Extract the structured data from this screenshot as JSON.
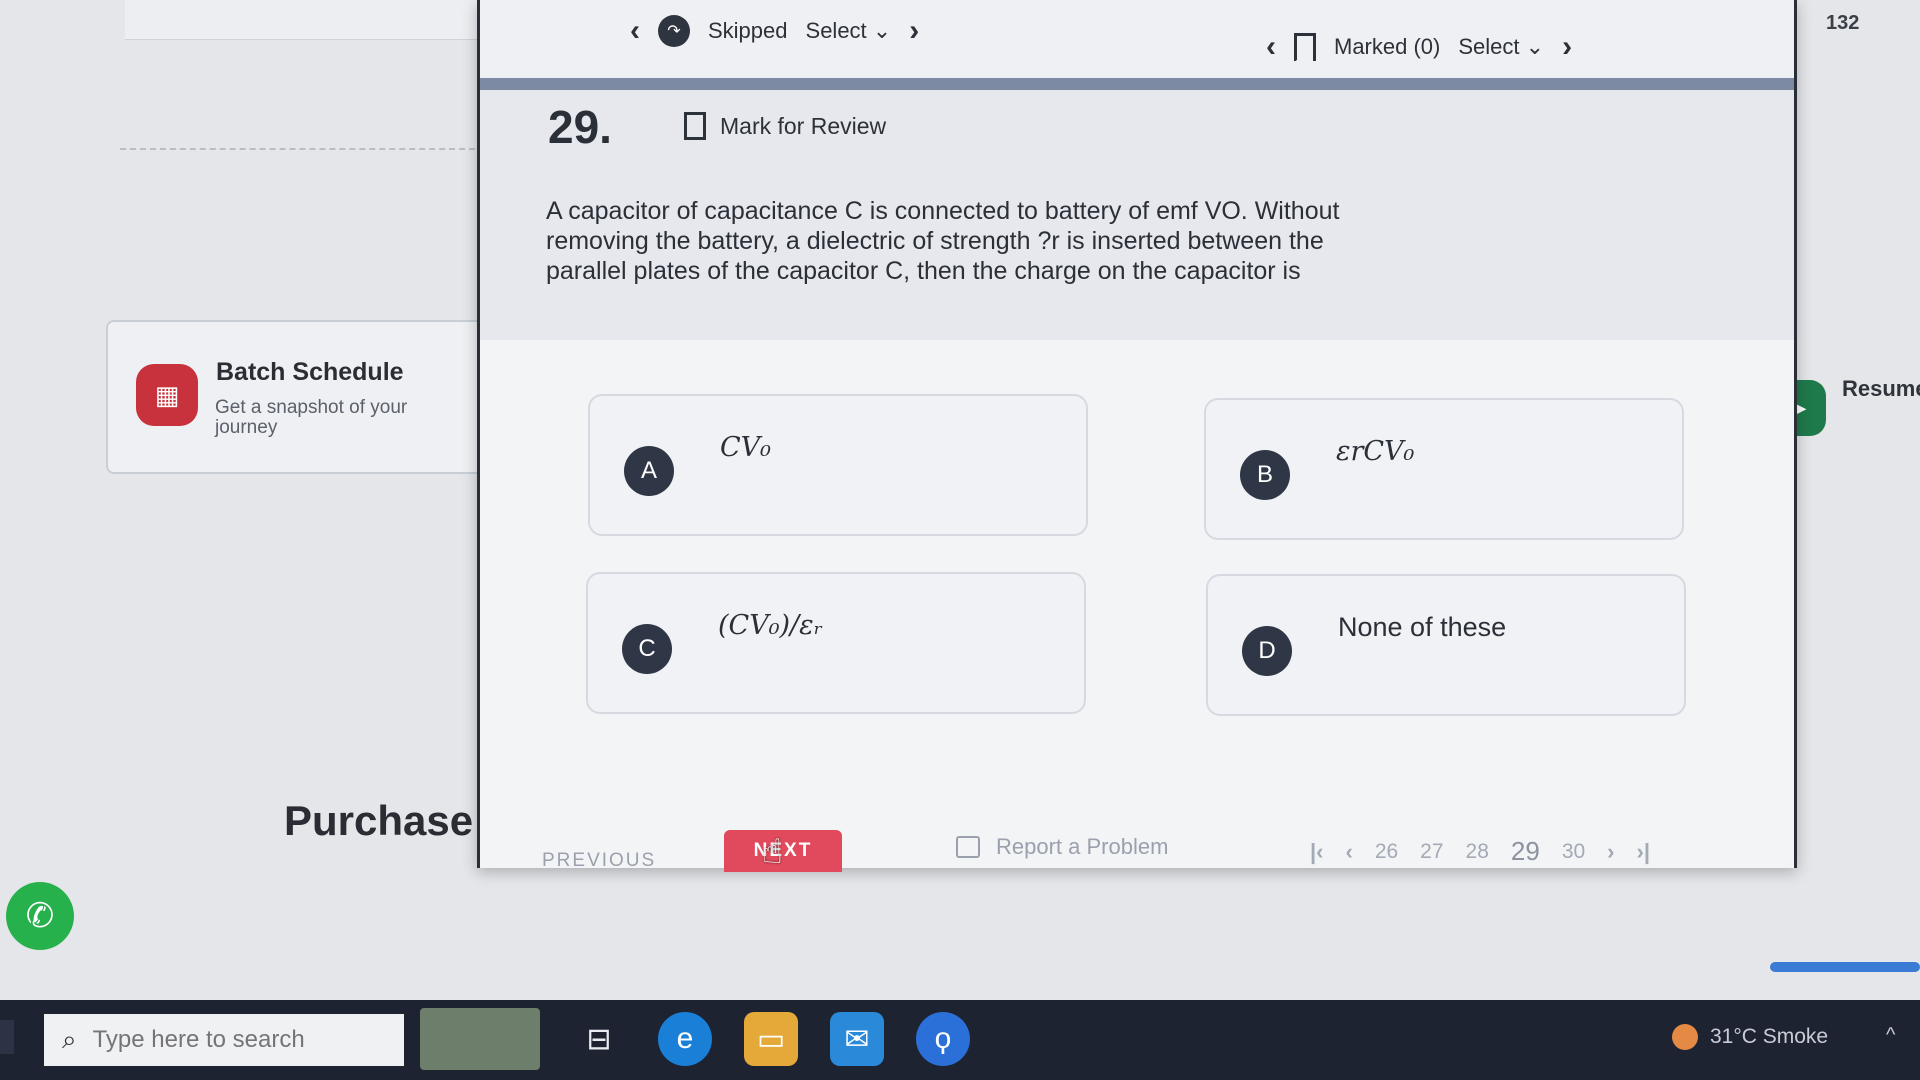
{
  "header": {
    "skipped_label": "Skipped",
    "skipped_select": "Select",
    "marked_label": "Marked (0)",
    "marked_select": "Select",
    "counter": "132"
  },
  "question": {
    "number": "29.",
    "mark_for_review": "Mark for Review",
    "text": "A capacitor of capacitance C is connected to battery of emf VO. Without removing the battery, a dielectric of strength ?r is inserted between the parallel plates of the capacitor C, then the charge on the capacitor is"
  },
  "options": [
    {
      "letter": "A",
      "text": "CV₀"
    },
    {
      "letter": "B",
      "text": "εrCV₀"
    },
    {
      "letter": "C",
      "text": "(CV₀)/εᵣ"
    },
    {
      "letter": "D",
      "text": "None of these"
    }
  ],
  "footer": {
    "previous_label": "PREVIOUS",
    "next_label": "NEXT",
    "report_label": "Report a Problem",
    "pages": [
      "26",
      "27",
      "28",
      "29",
      "30"
    ],
    "current_page": "29"
  },
  "background": {
    "batch_title": "Batch Schedule",
    "batch_subtitle": "Get a snapshot of your journey",
    "purchase": "Purchase",
    "resume_label": "Resume"
  },
  "taskbar": {
    "search_placeholder": "Type here to search",
    "weather": "31°C  Smoke"
  },
  "icons": {
    "whatsapp": "whatsapp-icon",
    "batch": "calendar-icon",
    "bookmark": "bookmark-icon"
  },
  "colors": {
    "next_button": "#e04a5c",
    "option_badge": "#2f3645",
    "batch_icon": "#c8323c",
    "whatsapp": "#27b14c"
  }
}
